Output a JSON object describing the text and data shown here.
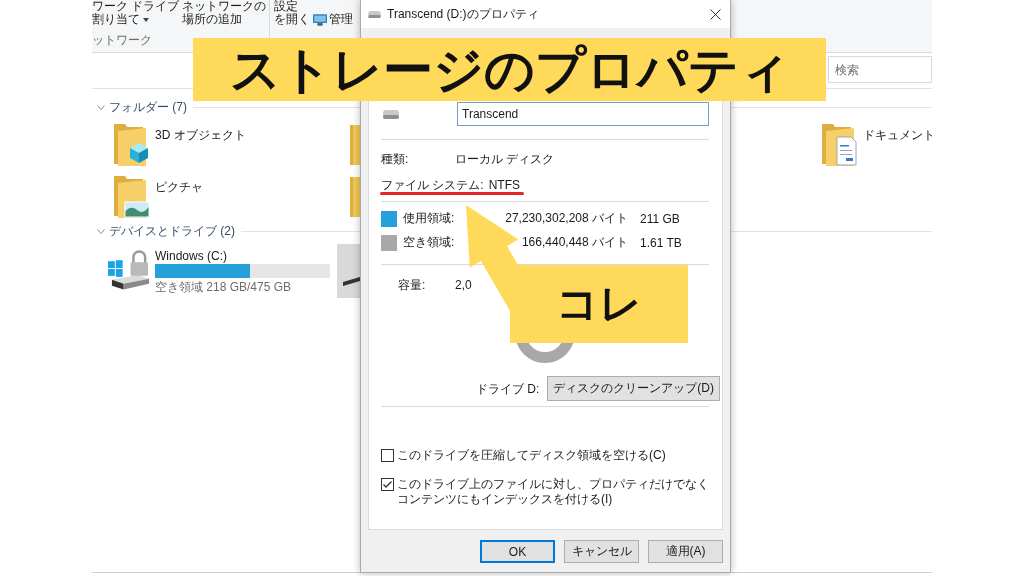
{
  "explorer": {
    "ribbon": {
      "groups": [
        {
          "label": "ットワーク",
          "commands": [
            {
              "kind": "large",
              "lines": [
                "ワーク ドライブ",
                "割り当て"
              ],
              "dropdown": true
            },
            {
              "kind": "large",
              "lines": [
                "ネットワークの",
                "場所の追加"
              ],
              "dropdown": false
            }
          ]
        },
        {
          "commands": [
            {
              "kind": "large",
              "lines": [
                "設定",
                "を開く"
              ],
              "dropdown": false
            },
            {
              "kind": "small",
              "lines": [
                "管理"
              ],
              "dropdown": false
            }
          ]
        }
      ]
    },
    "search": {
      "placeholder": "検索"
    },
    "sections": [
      {
        "kind": "folders",
        "title": "フォルダー (7)",
        "expanded": true,
        "items": [
          {
            "name": "3D オブジェクト",
            "kind": "objects"
          },
          {
            "name": "ドキュメント",
            "kind": "documents"
          },
          {
            "name": "ピクチャ",
            "kind": "pictures"
          }
        ]
      },
      {
        "kind": "drives",
        "title": "デバイスとドライブ (2)",
        "expanded": true,
        "items": [
          {
            "name": "Windows (C:)",
            "level": 0.54,
            "free_space": "空き領域 218 GB/475 GB",
            "selected": false
          },
          {
            "selected": true
          }
        ]
      }
    ]
  },
  "dialog": {
    "title": "Transcend (D:)のプロパティ",
    "name": "Transcend",
    "info": [
      {
        "label": "種類:",
        "value": "ローカル ディスク",
        "annotated": false
      },
      {
        "label": "ファイル システム:",
        "value": "NTFS",
        "annotated": true
      }
    ],
    "space": [
      {
        "label": "使用領域:",
        "bytes": "27,230,302,208 バイト",
        "size": "211 GB",
        "color": "#26a0da"
      },
      {
        "label": "空き領域:",
        "bytes": "166,440,448 バイト",
        "size": "1.61 TB",
        "color": "#a8a8a8"
      }
    ],
    "capacity": {
      "label": "容量:",
      "bytes": "2,0"
    },
    "drive_label": "ドライブ D:",
    "cleanup_button": "ディスクのクリーンアップ(D)",
    "options": [
      {
        "label": "このドライブを圧縮してディスク領域を空ける(C)",
        "checked": false
      },
      {
        "label": "このドライブ上のファイルに対し、プロパティだけでなくコンテンツにもインデックスを付ける(I)",
        "checked": true
      }
    ],
    "buttons": [
      {
        "label": "OK",
        "focused": true
      },
      {
        "label": "キャンセル",
        "focused": false
      },
      {
        "label": "適用(A)",
        "focused": false
      }
    ]
  },
  "annotations": {
    "banner": "ストレージのプロパティ",
    "callout": "コレ"
  }
}
